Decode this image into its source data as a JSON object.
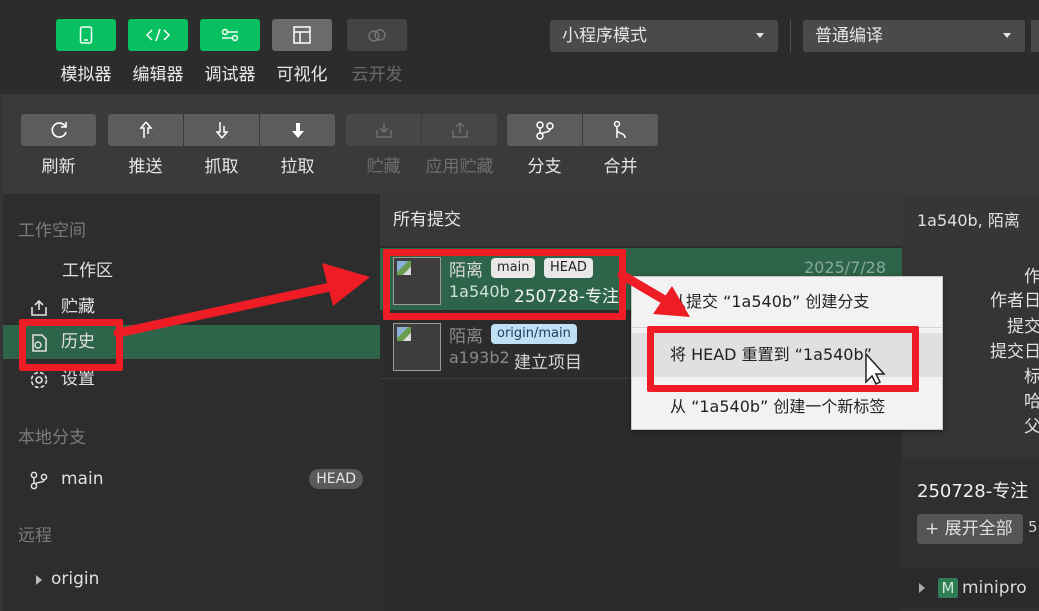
{
  "toolbar": {
    "buttons": [
      {
        "label": "模拟器",
        "icon": "phone-icon"
      },
      {
        "label": "编辑器",
        "icon": "code-icon"
      },
      {
        "label": "调试器",
        "icon": "debug-icon"
      },
      {
        "label": "可视化",
        "icon": "layout-icon"
      },
      {
        "label": "云开发",
        "icon": "cloud-icon"
      }
    ],
    "mode_select": "小程序模式",
    "compile_select": "普通编译"
  },
  "git_toolbar": {
    "buttons": [
      {
        "label": "刷新",
        "icon": "refresh-icon"
      },
      {
        "label": "推送",
        "icon": "push-icon"
      },
      {
        "label": "抓取",
        "icon": "fetch-icon"
      },
      {
        "label": "拉取",
        "icon": "pull-icon"
      },
      {
        "label": "贮藏",
        "icon": "stash-icon"
      },
      {
        "label": "应用贮藏",
        "icon": "apply-stash-icon"
      },
      {
        "label": "分支",
        "icon": "branch-icon"
      },
      {
        "label": "合并",
        "icon": "merge-icon"
      }
    ]
  },
  "sidebar": {
    "workspace_title": "工作空间",
    "items": [
      {
        "label": "工作区"
      },
      {
        "label": "贮藏",
        "icon": "stash-icon"
      },
      {
        "label": "历史",
        "icon": "history-icon"
      },
      {
        "label": "设置",
        "icon": "gear-icon"
      }
    ],
    "local_title": "本地分支",
    "branch": {
      "label": "main",
      "badge": "HEAD"
    },
    "remote_title": "远程",
    "remote": {
      "label": "origin"
    }
  },
  "commits": {
    "header": "所有提交",
    "list": [
      {
        "author": "陌离",
        "tags": [
          "main",
          "HEAD"
        ],
        "hash": "1a540b",
        "message": "250728-专注",
        "date": "2025/7/28"
      },
      {
        "author": "陌离",
        "tags": [
          "origin/main"
        ],
        "hash": "a193b2",
        "message": "建立项目",
        "date": ""
      }
    ]
  },
  "details": {
    "header": "1a540b, 陌离",
    "labels": [
      "作",
      "作者日",
      "提交",
      "提交日",
      "标",
      "哈",
      "父"
    ],
    "title": "250728-专注",
    "expand_label": "+ 展开全部",
    "count": "5",
    "file_badge": "M",
    "file_name": "minipro"
  },
  "context_menu": {
    "items": [
      "从提交 “1a540b” 创建分支",
      "将 HEAD 重置到 “1a540b”",
      "从 “1a540b” 创建一个新标签"
    ]
  },
  "colors": {
    "accent_green": "#07c160",
    "selection_green": "#2e6449",
    "annotation_red": "#ee1c25"
  }
}
